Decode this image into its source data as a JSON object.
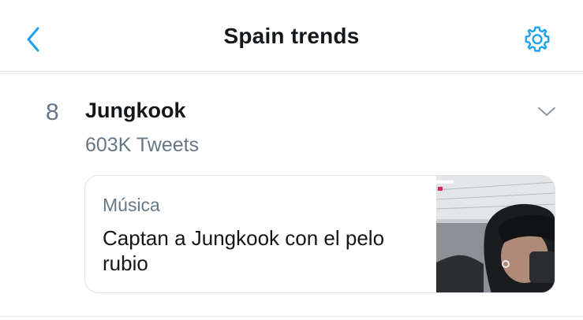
{
  "header": {
    "title": "Spain trends",
    "back_icon": "chevron-left-icon",
    "settings_icon": "gear-icon"
  },
  "trend": {
    "rank": "8",
    "name": "Jungkook",
    "tweet_count": "603K Tweets",
    "chevron_icon": "chevron-down-icon",
    "card": {
      "category": "Música",
      "headline": "Captan a Jungkook con el pelo rubio",
      "thumbnail_icon": "photo-thumbnail"
    }
  },
  "colors": {
    "accent": "#1da1f2",
    "text_primary": "#14171a",
    "text_secondary": "#657786",
    "divider": "#e6ecf0"
  }
}
